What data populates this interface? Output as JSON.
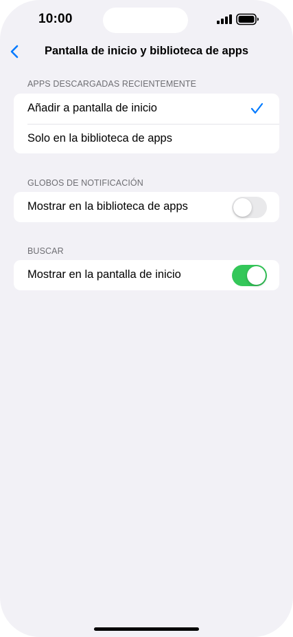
{
  "status_bar": {
    "time": "10:00"
  },
  "nav": {
    "title": "Pantalla de inicio y biblioteca de apps",
    "back_icon": "chevron-left-icon"
  },
  "sections": {
    "recent": {
      "header": "APPS DESCARGADAS RECIENTEMENTE",
      "options": [
        {
          "label": "Añadir a pantalla de inicio",
          "selected": true
        },
        {
          "label": "Solo en la biblioteca de apps",
          "selected": false
        }
      ]
    },
    "badges": {
      "header": "GLOBOS DE NOTIFICACIÓN",
      "row_label": "Mostrar en la biblioteca de apps",
      "toggle_on": false
    },
    "search": {
      "header": "BUSCAR",
      "row_label": "Mostrar en la pantalla de inicio",
      "toggle_on": true
    }
  },
  "colors": {
    "accent": "#007aff",
    "toggle_on": "#34c759",
    "toggle_off": "#e9e9eb",
    "background": "#f2f1f6"
  }
}
